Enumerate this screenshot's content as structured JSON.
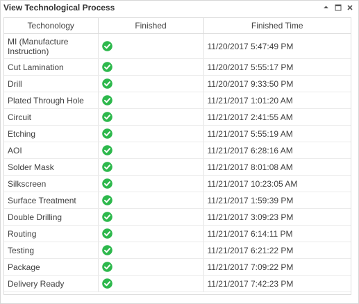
{
  "window": {
    "title": "View Technological Process",
    "controls": [
      {
        "name": "collapse-icon"
      },
      {
        "name": "maximize-icon"
      },
      {
        "name": "close-icon"
      }
    ]
  },
  "grid": {
    "columns": [
      "Techonology",
      "Finished",
      "Finished Time"
    ],
    "rows": [
      {
        "technology": "MI (Manufacture Instruction)",
        "finished": true,
        "time": "11/20/2017 5:47:49 PM"
      },
      {
        "technology": "Cut Lamination",
        "finished": true,
        "time": "11/20/2017 5:55:17 PM"
      },
      {
        "technology": "Drill",
        "finished": true,
        "time": "11/20/2017 9:33:50 PM"
      },
      {
        "technology": "Plated Through Hole",
        "finished": true,
        "time": "11/21/2017 1:01:20 AM"
      },
      {
        "technology": "Circuit",
        "finished": true,
        "time": "11/21/2017 2:41:55 AM"
      },
      {
        "technology": "Etching",
        "finished": true,
        "time": "11/21/2017 5:55:19 AM"
      },
      {
        "technology": "AOI",
        "finished": true,
        "time": "11/21/2017 6:28:16 AM"
      },
      {
        "technology": "Solder Mask",
        "finished": true,
        "time": "11/21/2017 8:01:08 AM"
      },
      {
        "technology": "Silkscreen",
        "finished": true,
        "time": "11/21/2017 10:23:05 AM"
      },
      {
        "technology": "Surface Treatment",
        "finished": true,
        "time": "11/21/2017 1:59:39 PM"
      },
      {
        "technology": "Double Drilling",
        "finished": true,
        "time": "11/21/2017 3:09:23 PM"
      },
      {
        "technology": "Routing",
        "finished": true,
        "time": "11/21/2017 6:14:11 PM"
      },
      {
        "technology": "Testing",
        "finished": true,
        "time": "11/21/2017 6:21:22 PM"
      },
      {
        "technology": "Package",
        "finished": true,
        "time": "11/21/2017 7:09:22 PM"
      },
      {
        "technology": "Delivery Ready",
        "finished": true,
        "time": "11/21/2017 7:42:23 PM"
      }
    ]
  },
  "colors": {
    "check_green": "#2db84c",
    "header_border": "#dcdcdc",
    "text": "#404040"
  }
}
